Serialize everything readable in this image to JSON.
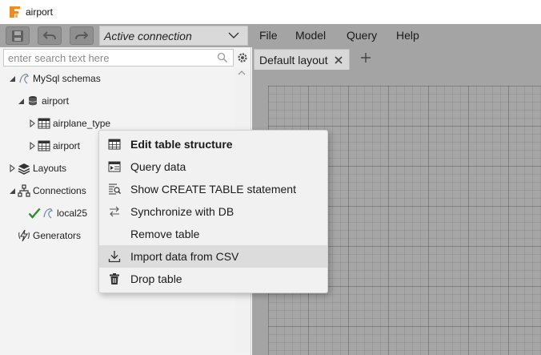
{
  "window": {
    "title": "airport"
  },
  "toolbar": {
    "connection": {
      "value": "Active connection"
    },
    "menu": [
      "File",
      "Model",
      "Query",
      "Help"
    ]
  },
  "left_panel": {
    "search": {
      "placeholder": "enter search text here"
    },
    "tree": [
      {
        "label": "MySql schemas",
        "icon": "mysql-dolphin-icon",
        "expanded": true
      },
      {
        "label": "airport",
        "icon": "database-icon",
        "expanded": true
      },
      {
        "label": "airplane_type",
        "icon": "table-icon",
        "expanded": false
      },
      {
        "label": "airport",
        "icon": "table-icon",
        "expanded": false
      },
      {
        "label": "Layouts",
        "icon": "layers-icon",
        "expanded": false
      },
      {
        "label": "Connections",
        "icon": "network-icon",
        "expanded": true
      },
      {
        "label": "local25",
        "icon": "mysql-dolphin-icon",
        "status": "connected"
      },
      {
        "label": "Generators",
        "icon": "generator-icon"
      }
    ]
  },
  "tabs": [
    {
      "label": "Default layout",
      "active": true
    }
  ],
  "context_menu": {
    "items": [
      {
        "label": "Edit table structure",
        "icon": "table-grid-icon",
        "bold": true
      },
      {
        "label": "Query data",
        "icon": "query-table-icon"
      },
      {
        "label": "Show CREATE TABLE statement",
        "icon": "sql-search-icon"
      },
      {
        "label": "Synchronize with DB",
        "icon": "sync-arrows-icon"
      },
      {
        "label": "Remove table",
        "icon": ""
      },
      {
        "label": "Import data from CSV",
        "icon": "download-icon",
        "highlighted": true
      },
      {
        "label": "Drop table",
        "icon": "trash-icon"
      }
    ]
  },
  "colors": {
    "accent_check": "#2e8b2e",
    "toolbar_bg": "#a4a4a4",
    "menu_hover": "#dcdcdc",
    "logo_orange": "#f08a24"
  }
}
